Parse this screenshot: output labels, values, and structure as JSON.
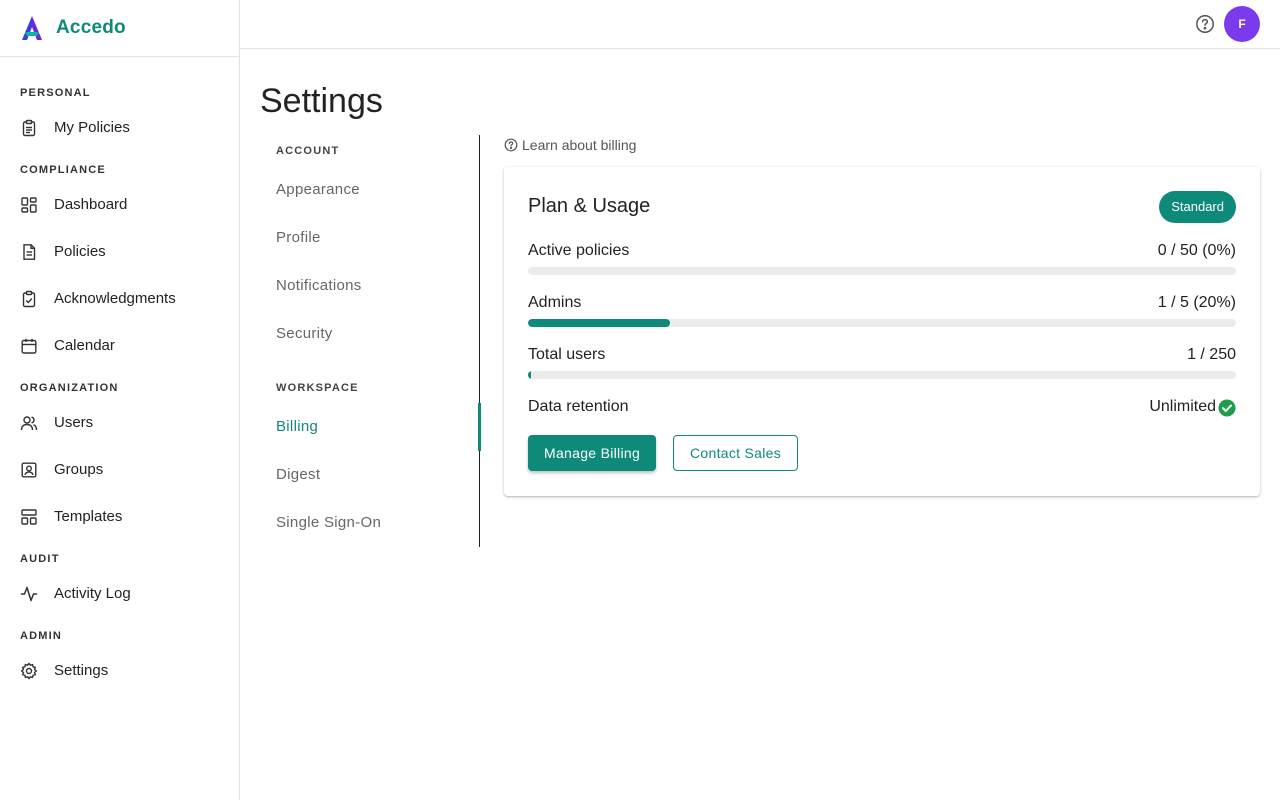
{
  "app": {
    "brand_name": "Accedo",
    "accent_color": "#0e8a7a",
    "avatar_color": "#7c3aed"
  },
  "sidebar": {
    "sections": [
      {
        "title": "PERSONAL",
        "items": [
          {
            "label": "My Policies",
            "icon": "clipboard-icon"
          }
        ]
      },
      {
        "title": "COMPLIANCE",
        "items": [
          {
            "label": "Dashboard",
            "icon": "dashboard-icon"
          },
          {
            "label": "Policies",
            "icon": "document-icon"
          },
          {
            "label": "Acknowledgments",
            "icon": "clipboard-check-icon"
          },
          {
            "label": "Calendar",
            "icon": "calendar-icon"
          }
        ]
      },
      {
        "title": "ORGANIZATION",
        "items": [
          {
            "label": "Users",
            "icon": "users-icon"
          },
          {
            "label": "Groups",
            "icon": "contact-card-icon"
          },
          {
            "label": "Templates",
            "icon": "templates-icon"
          }
        ]
      },
      {
        "title": "AUDIT",
        "items": [
          {
            "label": "Activity Log",
            "icon": "activity-icon"
          }
        ]
      },
      {
        "title": "ADMIN",
        "items": [
          {
            "label": "Settings",
            "icon": "gear-icon"
          }
        ]
      }
    ]
  },
  "topbar": {
    "help_icon": "help-circle-icon",
    "avatar_initial": "F"
  },
  "page": {
    "title": "Settings"
  },
  "settings_nav": {
    "account_title": "ACCOUNT",
    "account_items": [
      "Appearance",
      "Profile",
      "Notifications",
      "Security"
    ],
    "workspace_title": "WORKSPACE",
    "workspace_items": [
      "Billing",
      "Digest",
      "Single Sign-On"
    ],
    "active": "Billing"
  },
  "billing": {
    "learn_link": "Learn about billing",
    "card_title": "Plan & Usage",
    "plan_badge": "Standard",
    "usage": [
      {
        "label": "Active policies",
        "value": "0 / 50 (0%)",
        "fraction": 0
      },
      {
        "label": "Admins",
        "value": "1 / 5 (20%)",
        "fraction": 0.2
      },
      {
        "label": "Total users",
        "value": "1 / 250",
        "fraction": 0.004
      }
    ],
    "retention_label": "Data retention",
    "retention_value": "Unlimited",
    "retention_status_color": "#1e9e4a",
    "manage_button": "Manage Billing",
    "contact_button": "Contact Sales"
  }
}
